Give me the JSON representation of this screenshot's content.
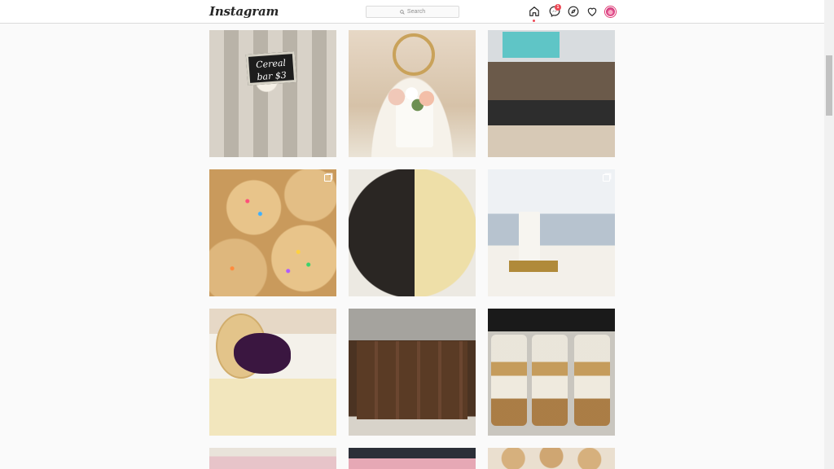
{
  "nav": {
    "logo": "Instagram",
    "search_placeholder": "Search",
    "messenger_badge": "1",
    "icons": [
      "home-icon",
      "messenger-icon",
      "explore-icon",
      "activity-heart-icon",
      "profile-avatar"
    ]
  },
  "grid": {
    "posts": [
      {
        "name": "post-cereal-bars",
        "sign_text": "Cereal bar $3",
        "multi": false
      },
      {
        "name": "post-floral-cake",
        "multi": false
      },
      {
        "name": "post-bakery-display",
        "multi": false
      },
      {
        "name": "post-sprinkle-cookies",
        "multi": true
      },
      {
        "name": "post-cookies-cream-platter",
        "multi": false
      },
      {
        "name": "post-wedding-cake",
        "multi": true
      },
      {
        "name": "post-blueberry-cheesecake",
        "multi": false
      },
      {
        "name": "post-brownie-trays",
        "multi": false
      },
      {
        "name": "post-dessert-cups",
        "multi": false
      },
      {
        "name": "post-partial-row-1",
        "multi": false
      },
      {
        "name": "post-partial-row-2",
        "multi": false
      },
      {
        "name": "post-partial-row-3",
        "multi": false
      }
    ]
  },
  "colors": {
    "accent": "#ed4956",
    "border": "#dbdbdb",
    "background": "#fafafa"
  }
}
